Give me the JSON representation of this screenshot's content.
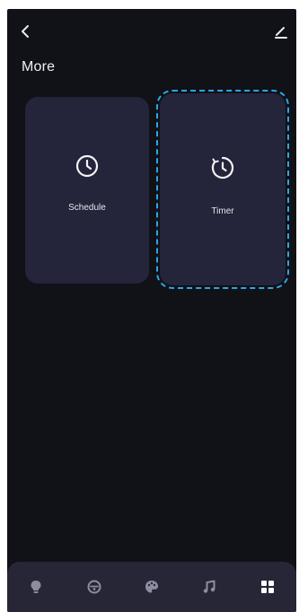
{
  "header": {
    "back_icon": "chevron-left-icon",
    "edit_icon": "edit-icon"
  },
  "page": {
    "title": "More"
  },
  "cards": [
    {
      "label": "Schedule",
      "icon": "clock-icon",
      "selected": false
    },
    {
      "label": "Timer",
      "icon": "timer-icon",
      "selected": true
    }
  ],
  "bottom_nav": {
    "items": [
      {
        "icon": "bulb-icon",
        "active": false
      },
      {
        "icon": "scene-icon",
        "active": false
      },
      {
        "icon": "palette-icon",
        "active": false
      },
      {
        "icon": "music-icon",
        "active": false
      },
      {
        "icon": "grid-icon",
        "active": true
      }
    ]
  },
  "colors": {
    "background": "#111118",
    "card": "#24243a",
    "nav": "#262637",
    "selection_outline": "#2aa7e6"
  }
}
